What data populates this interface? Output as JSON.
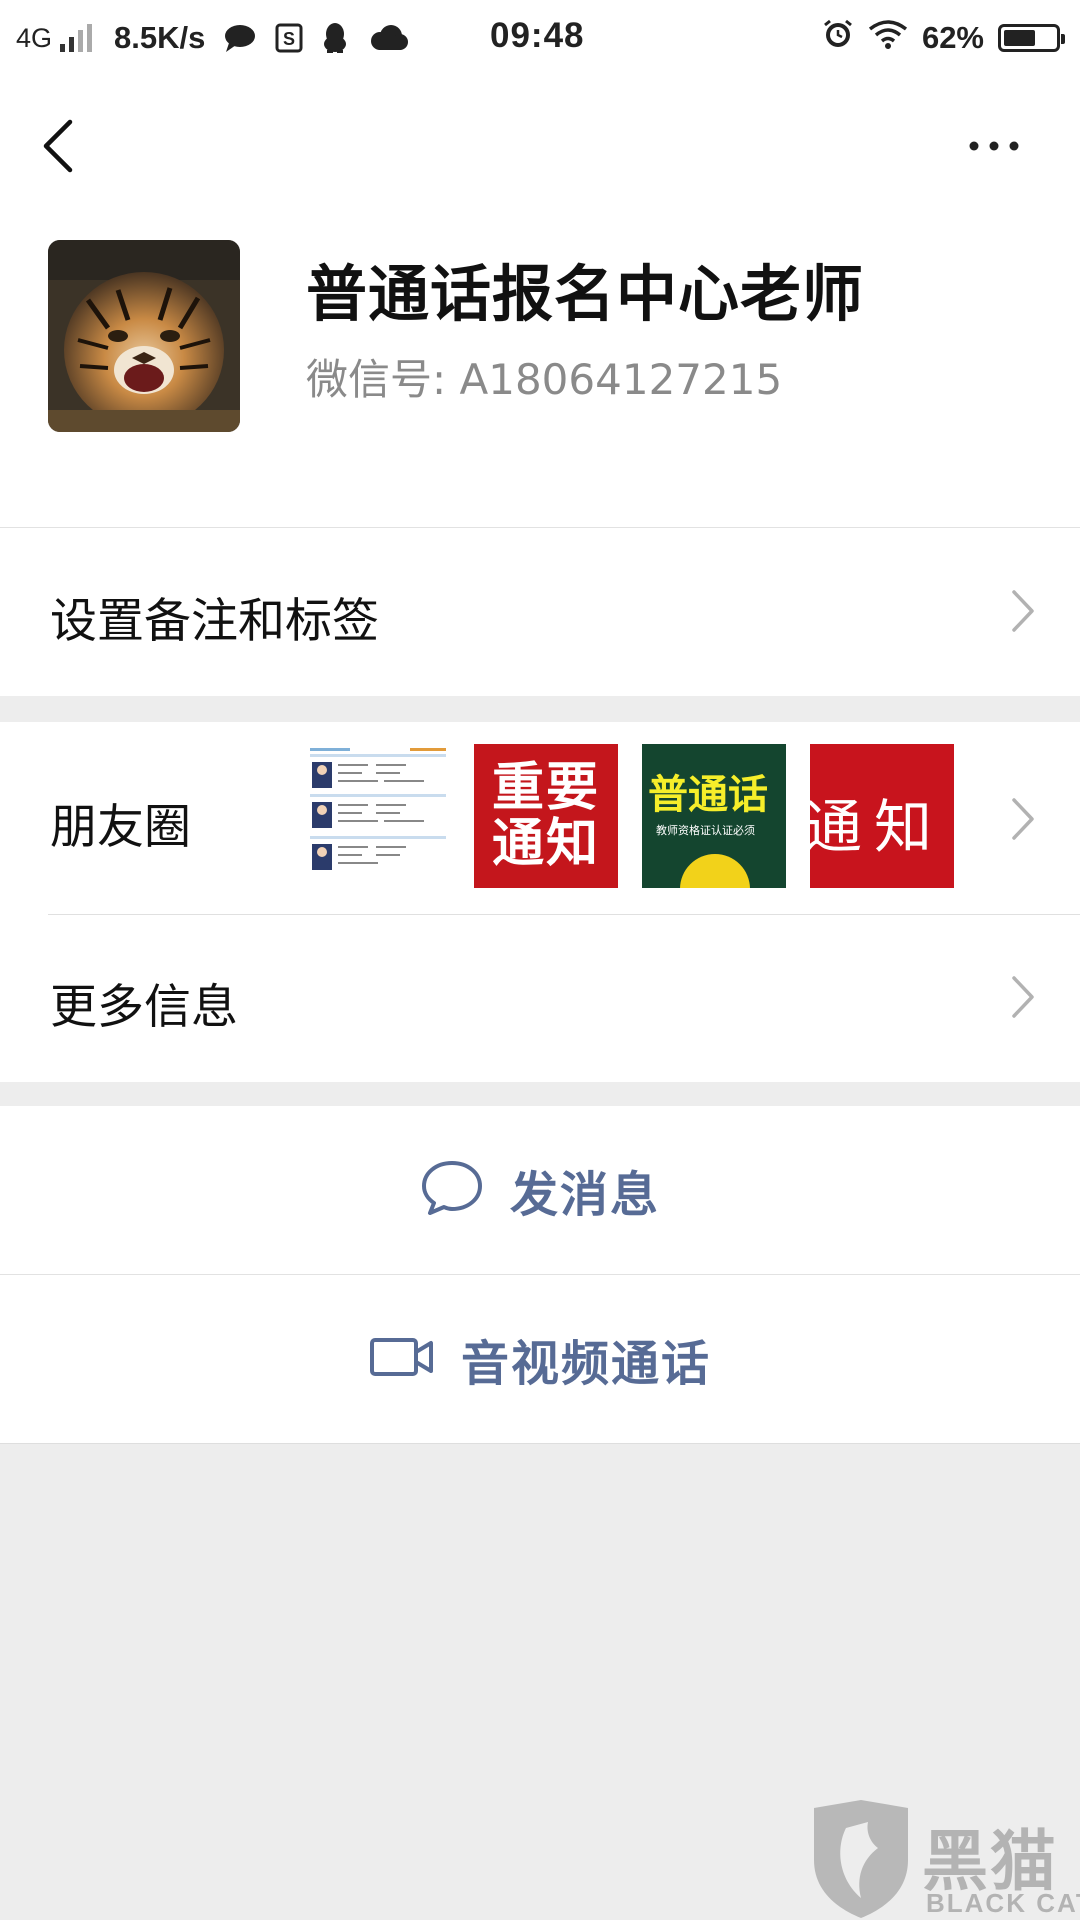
{
  "status_bar": {
    "network": "4G",
    "speed": "8.5K/s",
    "time": "09:48",
    "battery_percent": "62%",
    "battery_level": 0.62,
    "icons": [
      "signal-icon",
      "chat-bubble-icon",
      "s-app-icon",
      "qq-penguin-icon",
      "cloud-icon",
      "alarm-icon",
      "wifi-icon",
      "battery-icon"
    ]
  },
  "nav": {
    "back_icon": "chevron-left-icon",
    "more_icon": "more-dots-icon"
  },
  "profile": {
    "avatar_icon": "tiger-avatar",
    "name": "普通话报名中心老师",
    "wechat_id": "微信号:  A18064127215"
  },
  "rows": {
    "remark_label": "设置备注和标签",
    "moments_label": "朋友圈",
    "more_info_label": "更多信息"
  },
  "moments_thumbs": {
    "notice_text": "重要\n通知",
    "putonghua_text": "普通话",
    "putonghua_sub": "教师资格证认证必须",
    "tongzhi_text": "通知"
  },
  "actions": {
    "message_label": "发消息",
    "call_label": "音视频通话"
  },
  "watermark": {
    "text": "黑猫",
    "sub": "BLACK CAT"
  },
  "colors": {
    "link_blue": "#576b95",
    "background_gray": "#ededed",
    "white": "#ffffff"
  }
}
